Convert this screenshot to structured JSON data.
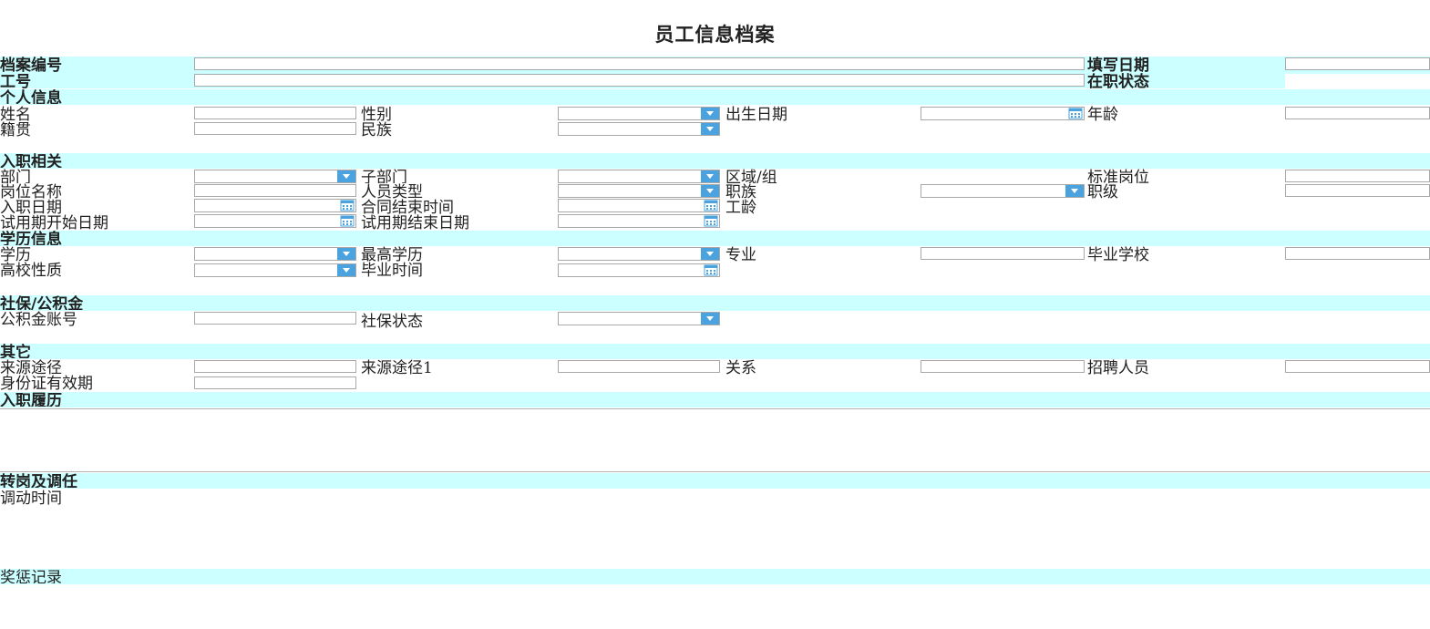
{
  "page": {
    "title": "员工信息档案"
  },
  "header": {
    "archive_no": "档案编号",
    "fill_date": "填写日期",
    "employee_no": "工号",
    "employment_status": "在职状态"
  },
  "sections": {
    "personal": "个人信息",
    "onboarding": "入职相关",
    "education": "学历信息",
    "social": "社保/公积金",
    "other": "其它",
    "history": "入职履历",
    "transfer": "转岗及调任",
    "rewards": "奖惩记录"
  },
  "personal": {
    "name": "姓名",
    "gender": "性别",
    "birth_date": "出生日期",
    "age": "年龄",
    "native_place": "籍贯",
    "ethnicity": "民族"
  },
  "onboarding": {
    "department": "部门",
    "sub_department": "子部门",
    "region_group": "区域/组",
    "standard_post": "标准岗位",
    "post_name": "岗位名称",
    "staff_type": "人员类型",
    "job_family": "职族",
    "job_level": "职级",
    "entry_date": "入职日期",
    "contract_end": "合同结束时间",
    "seniority": "工龄",
    "probation_start": "试用期开始日期",
    "probation_end": "试用期结束日期"
  },
  "education": {
    "degree": "学历",
    "highest_degree": "最高学历",
    "major": "专业",
    "school": "毕业学校",
    "school_type": "高校性质",
    "graduation_time": "毕业时间"
  },
  "social": {
    "fund_account": "公积金账号",
    "insurance_status": "社保状态"
  },
  "other": {
    "source": "来源途径",
    "source1": "来源途径1",
    "relation": "关系",
    "recruiter": "招聘人员",
    "id_valid": "身份证有效期"
  },
  "transfer": {
    "transfer_time": "调动时间"
  },
  "colors": {
    "band": "#ccffff",
    "accent": "#4aa3df",
    "border": "#a8a8a8"
  },
  "icons": {
    "dropdown": "chevron-down-icon",
    "date": "calendar-icon"
  }
}
